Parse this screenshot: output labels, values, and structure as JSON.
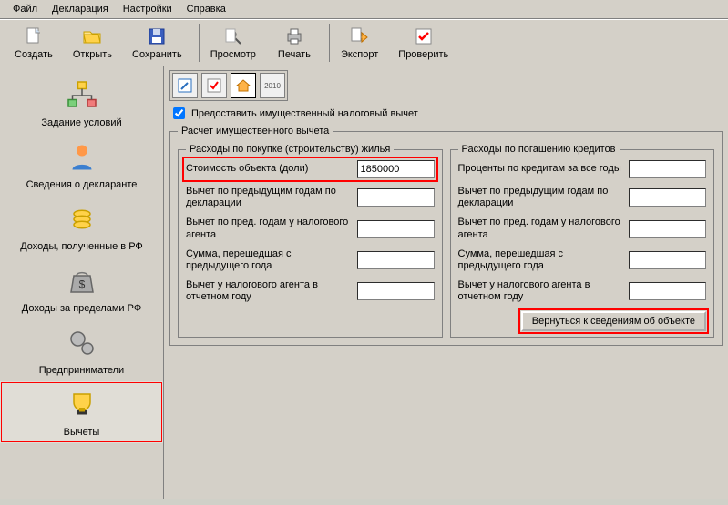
{
  "menu": [
    "Файл",
    "Декларация",
    "Настройки",
    "Справка"
  ],
  "toolbar": [
    {
      "name": "create",
      "label": "Создать",
      "icon": "doc-new"
    },
    {
      "name": "open",
      "label": "Открыть",
      "icon": "folder-open"
    },
    {
      "name": "save",
      "label": "Сохранить",
      "icon": "disk"
    },
    {
      "name": "preview",
      "label": "Просмотр",
      "icon": "magnifier",
      "sep": true
    },
    {
      "name": "print",
      "label": "Печать",
      "icon": "printer"
    },
    {
      "name": "export",
      "label": "Экспорт",
      "icon": "export",
      "sep": true
    },
    {
      "name": "check",
      "label": "Проверить",
      "icon": "check"
    }
  ],
  "sidebar": [
    {
      "name": "conditions",
      "label": "Задание условий",
      "icon": "tree"
    },
    {
      "name": "declarant",
      "label": "Сведения о декларанте",
      "icon": "person"
    },
    {
      "name": "income-rf",
      "label": "Доходы, полученные в РФ",
      "icon": "coins"
    },
    {
      "name": "income-foreign",
      "label": "Доходы за пределами РФ",
      "icon": "bag"
    },
    {
      "name": "entrepreneurs",
      "label": "Предприниматели",
      "icon": "gears"
    },
    {
      "name": "deductions",
      "label": "Вычеты",
      "icon": "trophy",
      "selected": true
    }
  ],
  "checkbox": {
    "label": "Предоставить имущественный налоговый вычет",
    "checked": true
  },
  "calc_title": "Расчет имущественного вычета",
  "left": {
    "title": "Расходы по покупке (строительству) жилья",
    "rows": [
      {
        "label": "Стоимость объекта (доли)",
        "value": "1850000",
        "hl": true
      },
      {
        "label": "Вычет по предыдущим годам по декларации",
        "value": ""
      },
      {
        "label": "Вычет по пред. годам у налогового агента",
        "value": ""
      },
      {
        "label": "Сумма, перешедшая с предыдущего года",
        "value": ""
      },
      {
        "label": "Вычет у налогового агента в отчетном году",
        "value": ""
      }
    ]
  },
  "right": {
    "title": "Расходы по погашению кредитов",
    "rows": [
      {
        "label": "Проценты по кредитам за все годы",
        "value": ""
      },
      {
        "label": "Вычет по предыдущим годам по декларации",
        "value": ""
      },
      {
        "label": "Вычет по пред. годам у налогового агента",
        "value": ""
      },
      {
        "label": "Сумма, перешедшая с предыдущего года",
        "value": ""
      },
      {
        "label": "Вычет у налогового агента в отчетном году",
        "value": ""
      }
    ]
  },
  "return_button": "Вернуться к сведениям об объекте",
  "tab_year": "2010"
}
